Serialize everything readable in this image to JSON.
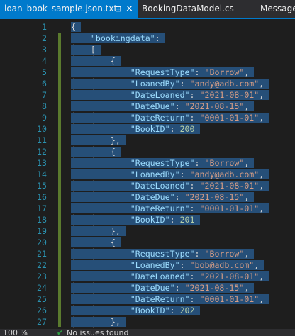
{
  "tabs": [
    {
      "label": "loan_book_sample.json.txt",
      "active": true,
      "pin": "⊞",
      "close": "×"
    },
    {
      "label": "BookingDataModel.cs",
      "active": false
    },
    {
      "label": "MessageC",
      "active": false
    }
  ],
  "editor": {
    "lines": [
      {
        "n": "1",
        "text": "{"
      },
      {
        "n": "2",
        "text": "    \"bookingdata\":"
      },
      {
        "n": "3",
        "text": "    ["
      },
      {
        "n": "4",
        "text": "        {"
      },
      {
        "n": "5",
        "text": "            \"RequestType\": \"Borrow\","
      },
      {
        "n": "6",
        "text": "            \"LoanedBy\": \"andy@adb.com\","
      },
      {
        "n": "7",
        "text": "            \"DateLoaned\": \"2021-08-01\","
      },
      {
        "n": "8",
        "text": "            \"DateDue\": \"2021-08-15\","
      },
      {
        "n": "9",
        "text": "            \"DateReturn\": \"0001-01-01\","
      },
      {
        "n": "10",
        "text": "            \"BookID\": 200"
      },
      {
        "n": "11",
        "text": "        },"
      },
      {
        "n": "12",
        "text": "        {"
      },
      {
        "n": "13",
        "text": "            \"RequestType\": \"Borrow\","
      },
      {
        "n": "14",
        "text": "            \"LoanedBy\": \"andy@adb.com\","
      },
      {
        "n": "15",
        "text": "            \"DateLoaned\": \"2021-08-01\","
      },
      {
        "n": "16",
        "text": "            \"DateDue\": \"2021-08-15\","
      },
      {
        "n": "17",
        "text": "            \"DateReturn\": \"0001-01-01\","
      },
      {
        "n": "18",
        "text": "            \"BookID\": 201"
      },
      {
        "n": "19",
        "text": "        },"
      },
      {
        "n": "20",
        "text": "        {"
      },
      {
        "n": "21",
        "text": "            \"RequestType\": \"Borrow\","
      },
      {
        "n": "22",
        "text": "            \"LoanedBy\": \"bob@adb.com\","
      },
      {
        "n": "23",
        "text": "            \"DateLoaned\": \"2021-08-01\","
      },
      {
        "n": "24",
        "text": "            \"DateDue\": \"2021-08-15\","
      },
      {
        "n": "25",
        "text": "            \"DateReturn\": \"0001-01-01\","
      },
      {
        "n": "26",
        "text": "            \"BookID\": 202"
      },
      {
        "n": "27",
        "text": "        },"
      }
    ],
    "selection_color": "#264f78",
    "modified_lines_color": "#5a7a2e"
  },
  "statusbar": {
    "zoom": "100 %",
    "issues_icon": "check-circle-icon",
    "issues_text": "No issues found"
  }
}
